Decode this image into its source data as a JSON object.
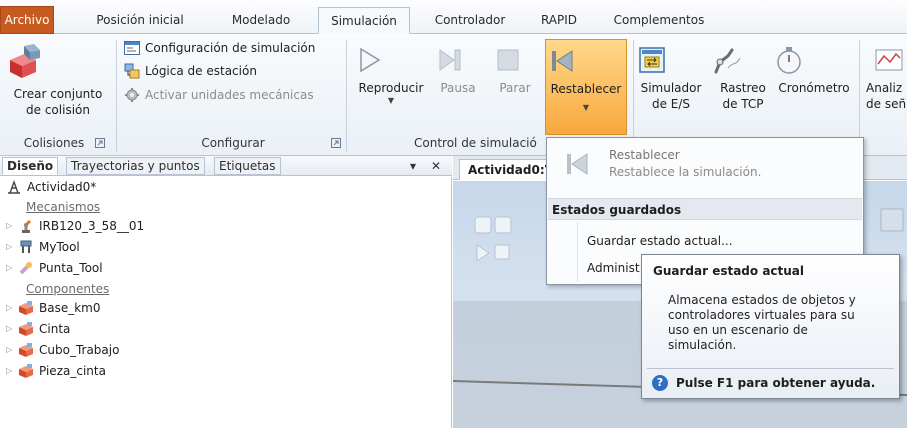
{
  "tabs": [
    {
      "label": "Archivo"
    },
    {
      "label": "Posición inicial"
    },
    {
      "label": "Modelado"
    },
    {
      "label": "Simulación"
    },
    {
      "label": "Controlador"
    },
    {
      "label": "RAPID"
    },
    {
      "label": "Complementos"
    }
  ],
  "ribbon": {
    "collisions": {
      "button_line1": "Crear conjunto",
      "button_line2": "de colisión",
      "group_label": "Colisiones"
    },
    "configure": {
      "items": [
        {
          "label": "Configuración de simulación",
          "icon": "config-window-icon"
        },
        {
          "label": "Lógica de estación",
          "icon": "station-logic-icon"
        },
        {
          "label": "Activar unidades mecánicas",
          "icon": "mechanical-units-icon"
        }
      ],
      "group_label": "Configurar"
    },
    "control": {
      "play": "Reproducir",
      "pause": "Pausa",
      "stop": "Parar",
      "reset": "Restablecer",
      "group_label": "Control de simulació"
    },
    "monitor": {
      "io_line1": "Simulador",
      "io_line2": "de E/S",
      "tcp_line1": "Rastreo",
      "tcp_line2": "de TCP",
      "timer": "Cronómetro",
      "signal_line1": "Analiz",
      "signal_line2": "de señ"
    }
  },
  "left_panel": {
    "tabs": [
      "Diseño",
      "Trayectorias y puntos",
      "Etiquetas"
    ],
    "pin": "▾",
    "close": "✕",
    "root": "Actividad0*",
    "mechanisms_label": "Mecanismos",
    "mechanisms": [
      "IRB120_3_58__01",
      "MyTool",
      "Punta_Tool"
    ],
    "components_label": "Componentes",
    "components": [
      "Base_km0",
      "Cinta",
      "Cubo_Trabajo",
      "Pieza_cinta"
    ]
  },
  "doc_tab": "Actividad0:V",
  "menu": {
    "reset_title": "Restablecer",
    "reset_desc": "Restablece la simulación.",
    "section": "Estados guardados",
    "save_state": "Guardar estado actual...",
    "manage_states": "Administ"
  },
  "tooltip": {
    "title": "Guardar estado actual",
    "body_lines": [
      "Almacena estados de objetos y",
      "controladores virtuales para su",
      "uso en un escenario de",
      "simulación."
    ],
    "help": "Pulse F1 para obtener ayuda."
  },
  "colors": {
    "file_tab": "#c75a1f",
    "highlight": "#f8a83d",
    "ribbon_bg": "#eaf0f6",
    "help_icon": "#2e6fc3"
  }
}
